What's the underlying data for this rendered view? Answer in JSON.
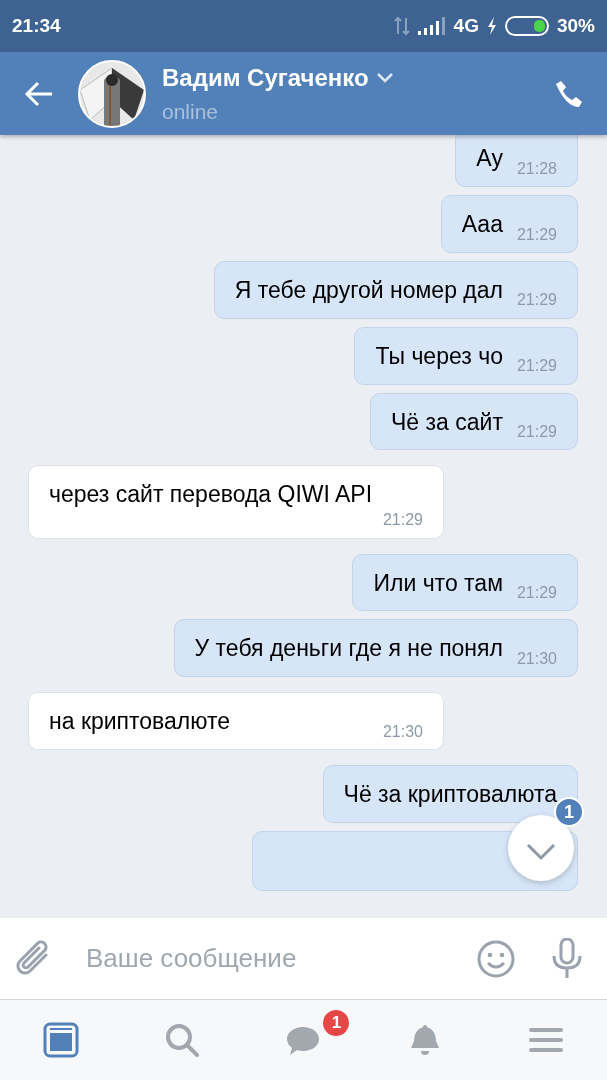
{
  "status_bar": {
    "time": "21:34",
    "network": "4G",
    "battery_text": "30%"
  },
  "header": {
    "name": "Вадим Сугаченко",
    "status": "online"
  },
  "messages": [
    {
      "text": "Ау",
      "time": "21:28",
      "outgoing": true
    },
    {
      "text": "Ааа",
      "time": "21:29",
      "outgoing": true
    },
    {
      "text": "Я тебе другой номер дал",
      "time": "21:29",
      "outgoing": true
    },
    {
      "text": "Ты через чо",
      "time": "21:29",
      "outgoing": true
    },
    {
      "text": "Чё за сайт",
      "time": "21:29",
      "outgoing": true
    },
    {
      "text": "через сайт перевода QIWI API",
      "time": "21:29",
      "outgoing": false
    },
    {
      "text": "Или что там",
      "time": "21:29",
      "outgoing": true
    },
    {
      "text": "У тебя деньги где я не понял",
      "time": "21:30",
      "outgoing": true
    },
    {
      "text": "на криптовалюте",
      "time": "21:30",
      "outgoing": false
    },
    {
      "text": "Чё за криптовалюта",
      "outgoing": true
    },
    {
      "outgoing": true
    }
  ],
  "scroll_button": {
    "badge": "1"
  },
  "composer": {
    "placeholder": "Ваше сообщение"
  },
  "tab_bar": [
    {
      "kind": "feed",
      "selected": true
    },
    {
      "kind": "search",
      "selected": false
    },
    {
      "kind": "messages",
      "selected": false,
      "badge": "1"
    },
    {
      "kind": "notifications",
      "selected": false
    },
    {
      "kind": "menu",
      "selected": false
    }
  ]
}
